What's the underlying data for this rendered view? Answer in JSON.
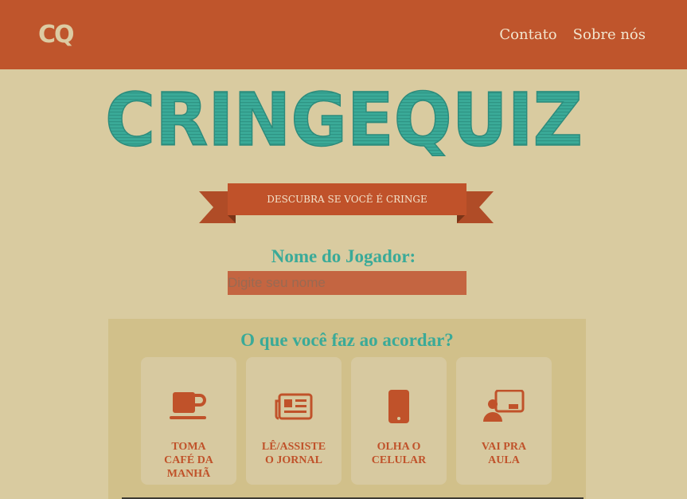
{
  "header": {
    "logo": "CQ",
    "nav": [
      {
        "label": "Contato"
      },
      {
        "label": "Sobre nós"
      }
    ]
  },
  "brand": {
    "title": "CRINGEQUIZ",
    "color": "#3aaa98"
  },
  "banner": {
    "text": "DESCUBRA SE VOCÊ É CRINGE"
  },
  "player": {
    "label": "Nome do Jogador:",
    "placeholder": "Digite seu nome",
    "value": ""
  },
  "question": {
    "text": "O que você faz ao acordar?",
    "options": [
      {
        "icon": "coffee-cup-icon",
        "label": "TOMA\nCAFÉ DA\nMANHÃ"
      },
      {
        "icon": "newspaper-icon",
        "label": "LÊ/ASSISTE\nO JORNAL"
      },
      {
        "icon": "mobile-phone-icon",
        "label": "OLHA O\nCELULAR"
      },
      {
        "icon": "classroom-icon",
        "label": "VAI PRA\nAULA"
      }
    ]
  },
  "colors": {
    "header_bg": "#bf552c",
    "page_bg": "#d9cba0",
    "accent_teal": "#3aaa98",
    "accent_orange": "#c0522a"
  }
}
